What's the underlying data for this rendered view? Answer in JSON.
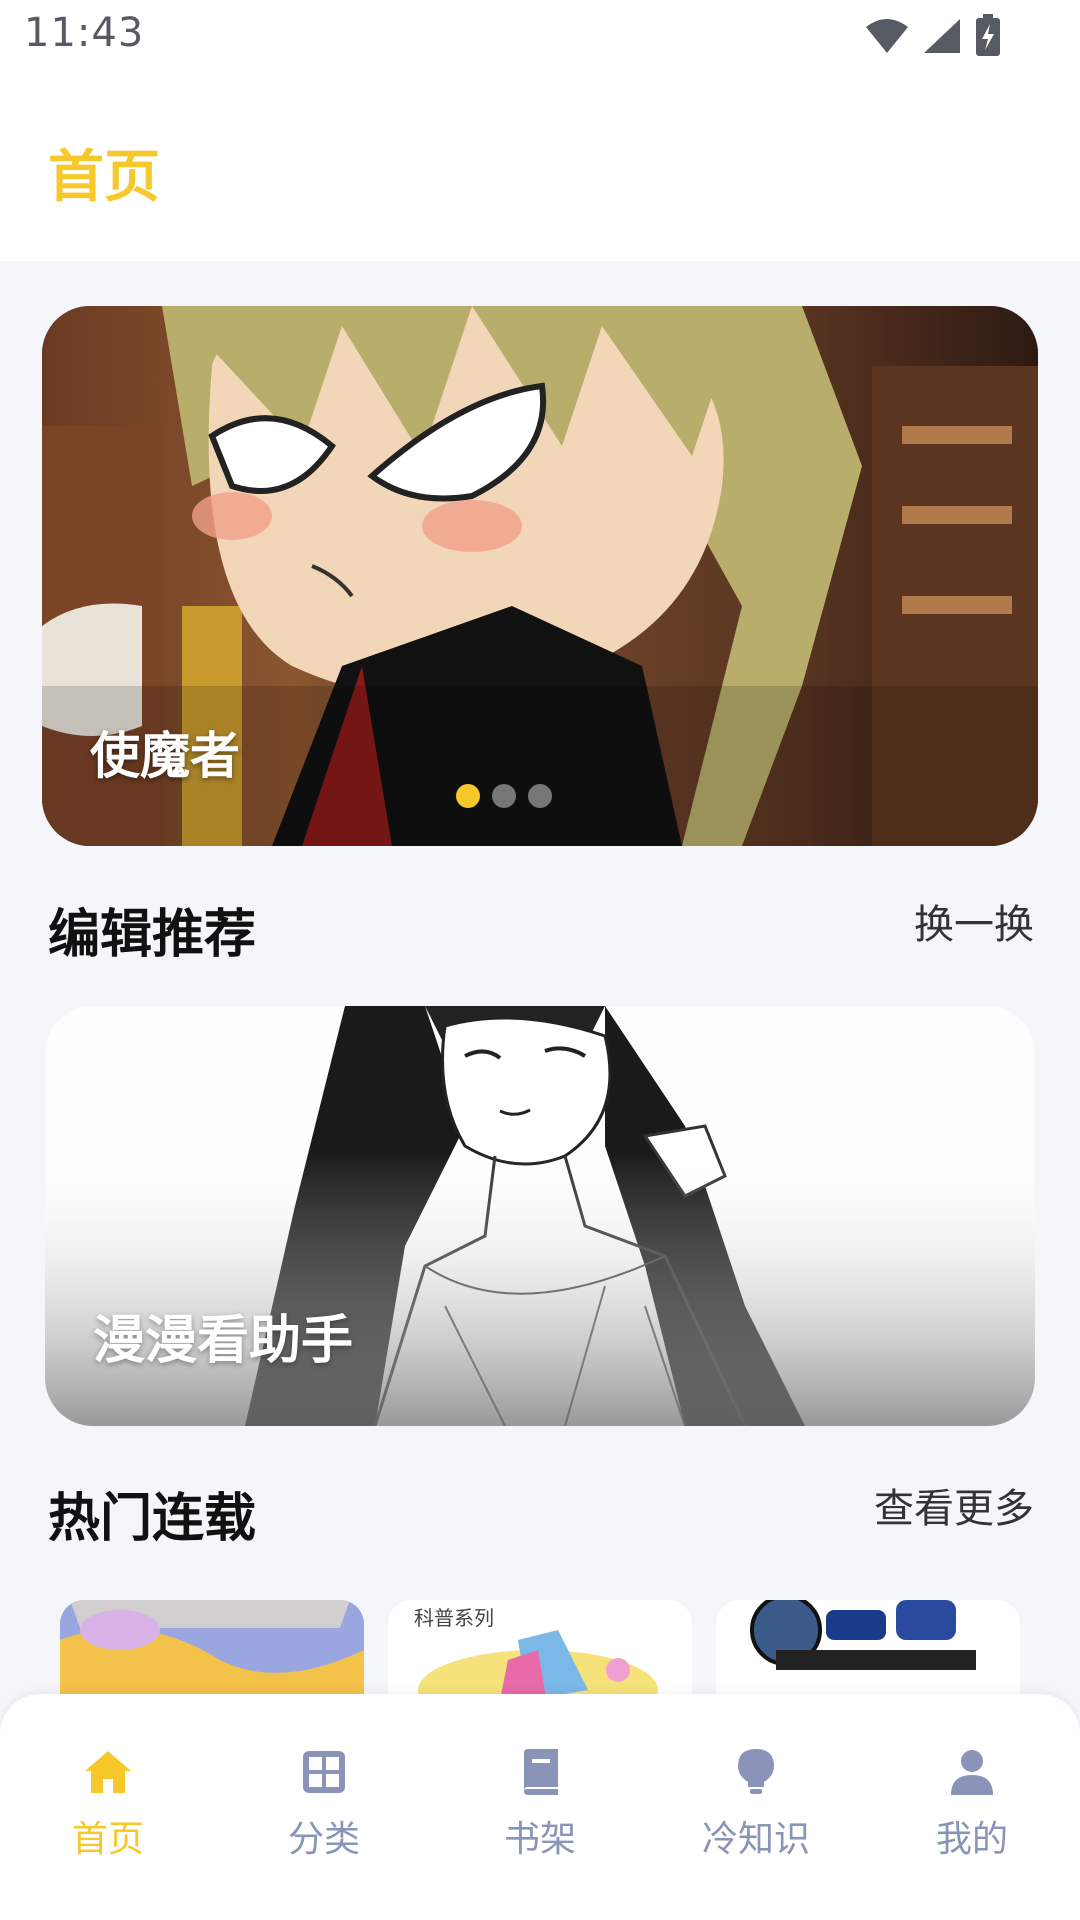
{
  "status_bar": {
    "time": "11:43"
  },
  "header": {
    "title": "首页"
  },
  "banner": {
    "title": "使魔者",
    "dots": {
      "count": 3,
      "active_index": 0
    }
  },
  "editor_section": {
    "title": "编辑推荐",
    "action_label": "换一换",
    "card_title": "漫漫看助手"
  },
  "hot_section": {
    "title": "热门连载",
    "action_label": "查看更多",
    "thumbnail_captions": [
      "科普系列"
    ]
  },
  "bottom_nav": {
    "items": [
      {
        "label": "首页",
        "icon": "home-icon",
        "active": true
      },
      {
        "label": "分类",
        "icon": "grid-icon",
        "active": false
      },
      {
        "label": "书架",
        "icon": "book-icon",
        "active": false
      },
      {
        "label": "冷知识",
        "icon": "lightbulb-icon",
        "active": false
      },
      {
        "label": "我的",
        "icon": "profile-icon",
        "active": false
      }
    ]
  },
  "colors": {
    "accent": "#f7c82a",
    "nav_inactive": "#8a93b8",
    "background": "#f5f6fa"
  }
}
